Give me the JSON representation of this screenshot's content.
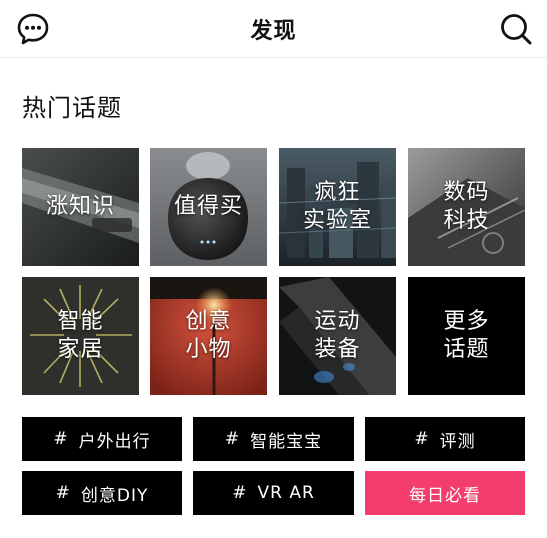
{
  "header": {
    "title": "发现",
    "left_icon": "chat-bubble-icon",
    "right_icon": "search-icon"
  },
  "section": {
    "title": "热门话题"
  },
  "topics": [
    {
      "label": "涨知识",
      "image": "product-photo"
    },
    {
      "label": "值得买",
      "image": "humidifier-photo"
    },
    {
      "label": "疯狂\n实验室",
      "image": "futuristic-city-photo"
    },
    {
      "label": "数码\n科技",
      "image": "hardware-photo"
    },
    {
      "label": "智能\n家居",
      "image": "lamp-rays-photo"
    },
    {
      "label": "创意\n小物",
      "image": "bulb-red-photo"
    },
    {
      "label": "运动\n装备",
      "image": "bike-photo"
    },
    {
      "label": "更多\n话题",
      "image": "plain-black"
    }
  ],
  "tags": [
    {
      "hash": "#",
      "label": "户外出行"
    },
    {
      "hash": "#",
      "label": "智能宝宝"
    },
    {
      "hash": "#",
      "label": "评测"
    },
    {
      "hash": "#",
      "label": "创意DIY"
    },
    {
      "hash": "#",
      "label": "VR AR"
    },
    {
      "hash": "",
      "label": "每日必看"
    }
  ],
  "colors": {
    "accent": "#f23d6d",
    "tag_bg": "#000000"
  }
}
